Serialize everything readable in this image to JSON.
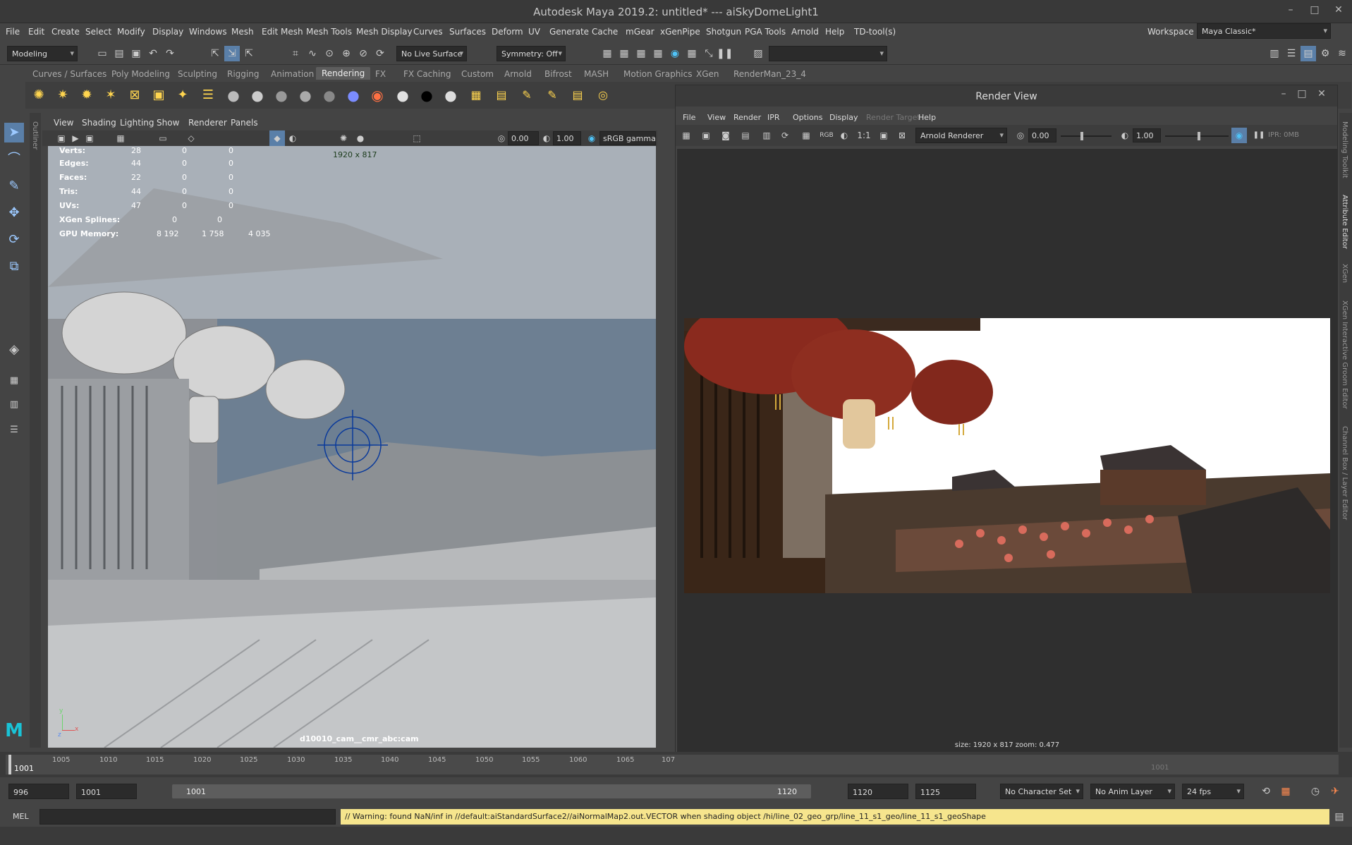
{
  "window": {
    "title": "Autodesk Maya 2019.2: untitled*   ---   aiSkyDomeLight1",
    "minimize": "–",
    "maximize": "□",
    "close": "✕"
  },
  "menubar": [
    "File",
    "Edit",
    "Create",
    "Select",
    "Modify",
    "Display",
    "Windows",
    "Mesh",
    "Edit Mesh",
    "Mesh Tools",
    "Mesh Display",
    "Curves",
    "Surfaces",
    "Deform",
    "UV",
    "Generate",
    "Cache",
    "mGear",
    "xGenPipe",
    "Shotgun",
    "PGA Tools",
    "Arnold",
    "Help",
    "TD-tool(s)"
  ],
  "workspace": {
    "label": "Workspace :",
    "value": "Maya Classic*"
  },
  "statusline": {
    "menuset": "Modeling",
    "live_surface": "No Live Surface",
    "symmetry": "Symmetry: Off"
  },
  "shelf_tabs": [
    "Curves / Surfaces",
    "Poly Modeling",
    "Sculpting",
    "Rigging",
    "Animation",
    "Rendering",
    "FX",
    "FX Caching",
    "Custom",
    "Arnold",
    "Bifrost",
    "MASH",
    "Motion Graphics",
    "XGen",
    "RenderMan_23_4"
  ],
  "shelf_active_tab": "Rendering",
  "viewport": {
    "menus": [
      "View",
      "Shading",
      "Lighting",
      "Show",
      "Renderer",
      "Panels"
    ],
    "exposure": "0.00",
    "gamma": "1.00",
    "colorspace": "sRGB gamma",
    "resolution": "1920 x 817",
    "camera": "d10010_cam__cmr_abc:cam",
    "hud": [
      {
        "label": "Verts:",
        "a": "28",
        "b": "0",
        "c": "0"
      },
      {
        "label": "Edges:",
        "a": "44",
        "b": "0",
        "c": "0"
      },
      {
        "label": "Faces:",
        "a": "22",
        "b": "0",
        "c": "0"
      },
      {
        "label": "Tris:",
        "a": "44",
        "b": "0",
        "c": "0"
      },
      {
        "label": "UVs:",
        "a": "47",
        "b": "0",
        "c": "0"
      }
    ],
    "xgen": {
      "label": "XGen Splines:",
      "a": "0",
      "b": "0"
    },
    "gpu": {
      "label": "GPU Memory:",
      "a": "8 192",
      "b": "1 758",
      "c": "4 035"
    },
    "axis_y": "y",
    "axis_x": "x",
    "axis_z": "z"
  },
  "outliner_label": "Outliner",
  "render_view": {
    "title": "Render View",
    "menus": [
      "File",
      "View",
      "Render",
      "IPR",
      "Options",
      "Display",
      "Render Target",
      "Help"
    ],
    "renderer": "Arnold Renderer",
    "exposure": "0.00",
    "gamma": "1.00",
    "ratio": "1:1",
    "rgb": "RGB",
    "ipr_mem": "IPR: 0MB",
    "status": "size: 1920 x 817 zoom: 0.477"
  },
  "timeline": {
    "current_frame": "1001",
    "ticks": [
      "1005",
      "1010",
      "1015",
      "1020",
      "1025",
      "1030",
      "1035",
      "1040",
      "1045",
      "1050",
      "1055",
      "1060",
      "1065",
      "107"
    ],
    "end_frame_overlay": "1001"
  },
  "range": {
    "start": "996",
    "playback_start": "1001",
    "slider_start": "1001",
    "slider_end": "1120",
    "playback_end": "1120",
    "end": "1125",
    "character_set": "No Character Set",
    "anim_layer": "No Anim Layer",
    "fps": "24 fps"
  },
  "command": {
    "mel_label": "MEL",
    "warning": "// Warning: found NaN/inf in //default:aiStandardSurface2//aiNormalMap2.out.VECTOR when shading object /hi/line_02_geo_grp/line_11_s1_geo/line_11_s1_geoShape"
  },
  "side_tabs": [
    "Modeling Toolkit",
    "Attribute Editor",
    "XGen",
    "XGen Interactive Groom Editor",
    "Channel Box / Layer Editor"
  ]
}
